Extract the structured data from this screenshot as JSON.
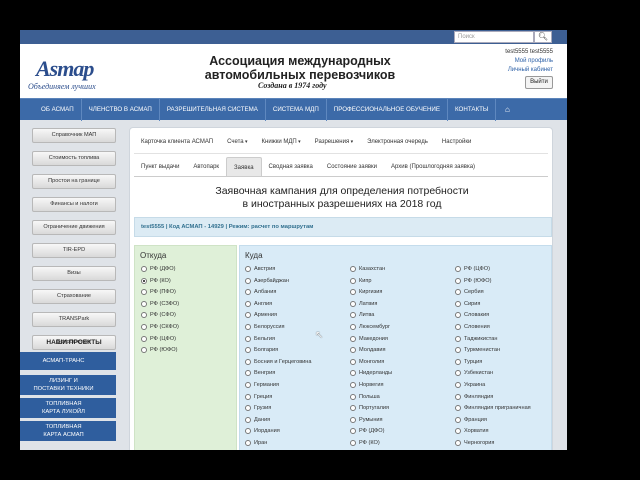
{
  "topbar": {
    "search_placeholder": "Поиск",
    "search_icon": "search-icon"
  },
  "header": {
    "logo_text": "Asmap",
    "logo_slogan": "Объединяем лучших",
    "title_line1": "Ассоциация международных",
    "title_line2": "автомобильных перевозчиков",
    "subtitle": "Создана в 1974 году",
    "user_name": "test5555 test5555",
    "profile_link": "Мой профиль",
    "cabinet_link": "Личный кабинет",
    "logout_label": "Выйти"
  },
  "nav": {
    "items": [
      "ОБ АСМАП",
      "ЧЛЕНСТВО В АСМАП",
      "РАЗРЕШИТЕЛЬНАЯ СИСТЕМА",
      "СИСТЕМА МДП",
      "ПРОФЕССИОНАЛЬНОЕ ОБУЧЕНИЕ",
      "КОНТАКТЫ"
    ],
    "home_icon": "home-icon"
  },
  "sidebar": {
    "items": [
      "Справочник МАП",
      "Стоимость топлива",
      "Простои на границе",
      "Финансы и налоги",
      "Ограничение движения",
      "TIR-EPD",
      "Визы",
      "Страхование",
      "TRANSPark",
      "Вопрос-ответ"
    ],
    "projects_title": "НАШИ ПРОЕКТЫ",
    "projects": [
      {
        "line1": "АСМАП-ТРАНС",
        "line2": ""
      },
      {
        "line1": "ЛИЗИНГ И",
        "line2": "ПОСТАВКИ ТЕХНИКИ"
      },
      {
        "line1": "ТОПЛИВНАЯ",
        "line2": "КАРТА ЛУКОЙЛ"
      },
      {
        "line1": "ТОПЛИВНАЯ",
        "line2": "КАРТА АСМАП"
      }
    ]
  },
  "main": {
    "tabs1": [
      {
        "label": "Карточка клиента АСМАП",
        "caret": false
      },
      {
        "label": "Счета",
        "caret": true
      },
      {
        "label": "Книжки МДП",
        "caret": true
      },
      {
        "label": "Разрешения",
        "caret": true
      },
      {
        "label": "Электронная очередь",
        "caret": false
      },
      {
        "label": "Настройки",
        "caret": false
      }
    ],
    "tabs2": [
      {
        "label": "Пункт выдачи",
        "active": false
      },
      {
        "label": "Автопарк",
        "active": false
      },
      {
        "label": "Заявка",
        "active": true
      },
      {
        "label": "Сводная заявка",
        "active": false
      },
      {
        "label": "Состояние заявки",
        "active": false
      },
      {
        "label": "Архив (Прошлогодняя заявка)",
        "active": false
      }
    ],
    "campaign_title_line1": "Заявочная кампания для определения потребности",
    "campaign_title_line2": "в иностранных разрешениях на 2018 год",
    "info_bar": "test5555 | Код АСМАП - 14929 | Режим: расчет по маршрутам",
    "from_title": "Откуда",
    "from_options": [
      {
        "label": "РФ (ДФО)",
        "checked": false
      },
      {
        "label": "РФ (КО)",
        "checked": true
      },
      {
        "label": "РФ (ПФО)",
        "checked": false
      },
      {
        "label": "РФ (СЗФО)",
        "checked": false
      },
      {
        "label": "РФ (СФО)",
        "checked": false
      },
      {
        "label": "РФ (СКФО)",
        "checked": false
      },
      {
        "label": "РФ (ЦФО)",
        "checked": false
      },
      {
        "label": "РФ (ЮФО)",
        "checked": false
      }
    ],
    "to_title": "Куда",
    "to_col1": [
      "Австрия",
      "Азербайджан",
      "Албания",
      "Англия",
      "Армения",
      "Белоруссия",
      "Бельгия",
      "Болгария",
      "Босния и Герцеговина",
      "Венгрия",
      "Германия",
      "Греция",
      "Грузия",
      "Дания",
      "Иордания",
      "Иран"
    ],
    "to_col2": [
      "Казахстан",
      "Кипр",
      "Киргизия",
      "Латвия",
      "Литва",
      "Люксембург",
      "Македония",
      "Молдавия",
      "Монголия",
      "Нидерланды",
      "Норвегия",
      "Польша",
      "Португалия",
      "Румыния",
      "РФ (ДФО)",
      "РФ (КО)"
    ],
    "to_col3": [
      "РФ (ЦФО)",
      "РФ (ЮФО)",
      "Сербия",
      "Сирия",
      "Словакия",
      "Словения",
      "Таджикистан",
      "Туркменистан",
      "Турция",
      "Узбекистан",
      "Украина",
      "Финляндия",
      "Финляндия приграничная",
      "Франция",
      "Хорватия",
      "Черногория"
    ]
  }
}
